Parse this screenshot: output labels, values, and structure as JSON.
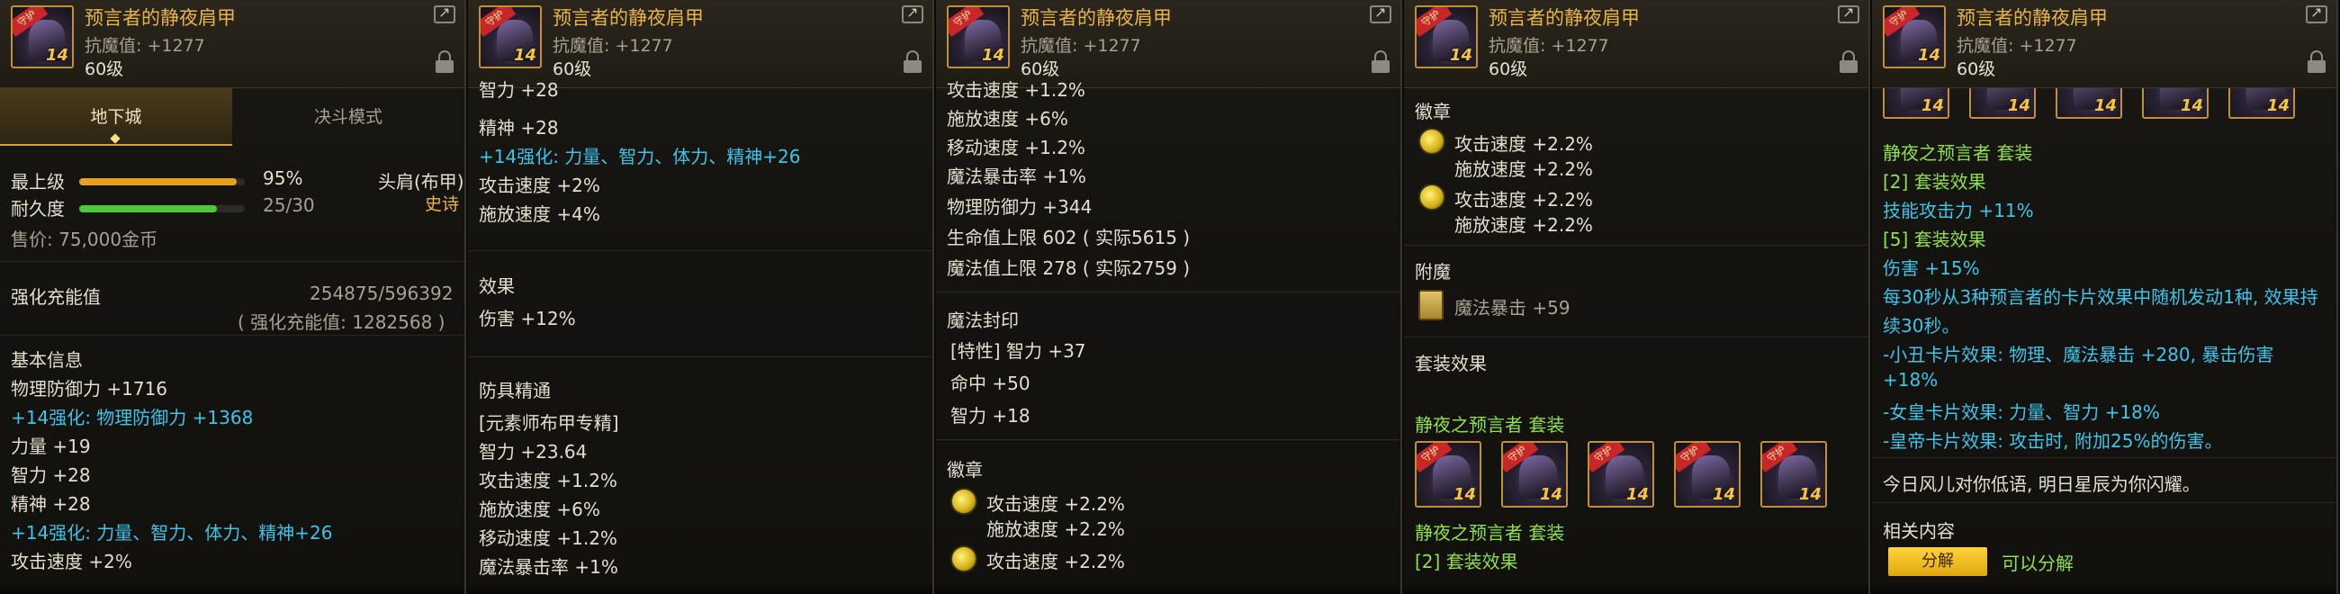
{
  "item": {
    "name": "预言者的静夜肩甲",
    "resist": "抗魔值: +1277",
    "level": "60级",
    "icon_tag": "守护",
    "icon_level": "14"
  },
  "panel1": {
    "tabs": [
      "地下城",
      "决斗模式"
    ],
    "grade_label": "最上级",
    "grade_value": "95%",
    "grade_fraction": 0.95,
    "slot": "头肩(布甲)",
    "rarity": "史诗",
    "durability_label": "耐久度",
    "durability_value": "25/30",
    "durability_fraction": 0.833,
    "price": "售价: 75,000金币",
    "charge_label": "强化充能值",
    "charge_value": "254875/596392",
    "charge_sub": "( 强化充能值: 1282568 )",
    "basic_label": "基本信息",
    "lines": [
      "物理防御力 +1716",
      "+14强化: 物理防御力 +1368",
      "力量 +19",
      "智力 +28",
      "精神 +28",
      "+14强化: 力量、智力、体力、精神+26",
      "攻击速度 +2%"
    ]
  },
  "panel2": {
    "top_cut": "智力 +28",
    "lines_a": [
      "精神 +28",
      "+14强化: 力量、智力、体力、精神+26",
      "攻击速度 +2%",
      "施放速度 +4%"
    ],
    "effect_label": "效果",
    "effect": "伤害 +12%",
    "mastery_label": "防具精通",
    "mastery_sub": "[元素师布甲专精]",
    "lines_b": [
      "智力 +23.64",
      "攻击速度 +1.2%",
      "施放速度 +6%",
      "移动速度 +1.2%",
      "魔法暴击率 +1%"
    ]
  },
  "panel3": {
    "top_cut": "攻击速度 +1.2%",
    "lines_a": [
      "施放速度 +6%",
      "移动速度 +1.2%",
      "魔法暴击率 +1%",
      "物理防御力 +344",
      "生命值上限 602 ( 实际5615 )",
      "魔法值上限 278 ( 实际2759 )"
    ],
    "seal_label": "魔法封印",
    "seal_lines": [
      "[特性] 智力 +37",
      "命中 +50",
      "智力 +18"
    ],
    "emblem_label": "徽章",
    "emblem1": [
      "攻击速度 +2.2%",
      "施放速度 +2.2%"
    ],
    "emblem2": [
      "攻击速度 +2.2%"
    ]
  },
  "panel4": {
    "emblem_label": "徽章",
    "emblem1": [
      "攻击速度 +2.2%",
      "施放速度 +2.2%"
    ],
    "emblem2": [
      "攻击速度 +2.2%",
      "施放速度 +2.2%"
    ],
    "enchant_label": "附魔",
    "enchant": "魔法暴击 +59",
    "set_effect_label": "套装效果",
    "set_name": "静夜之预言者  套装",
    "set_name2": "静夜之预言者  套装",
    "set_tier": "[2] 套装效果"
  },
  "panel5": {
    "set_name": "静夜之预言者  套装",
    "tier2": "[2] 套装效果",
    "tier2_line": "技能攻击力 +11%",
    "tier5": "[5] 套装效果",
    "tier5_lines": [
      "伤害 +15%",
      "每30秒从3种预言者的卡片效果中随机发动1种, 效果持",
      "续30秒。",
      "-小丑卡片效果: 物理、魔法暴击 +280, 暴击伤害",
      "+18%",
      "-女皇卡片效果: 力量、智力 +18%",
      "-皇帝卡片效果: 攻击时, 附加25%的伤害。"
    ],
    "flavor": "今日风儿对你低语, 明日星辰为你闪耀。",
    "related_label": "相关内容",
    "disassemble_button": "分解",
    "disassemble_status": "可以分解"
  },
  "colors": {
    "title": "#e8b44a",
    "enhance": "#3fc4e8",
    "set": "#8fe04e",
    "grade_bar": "#e8a020",
    "durability_bar": "#4cc83a"
  }
}
